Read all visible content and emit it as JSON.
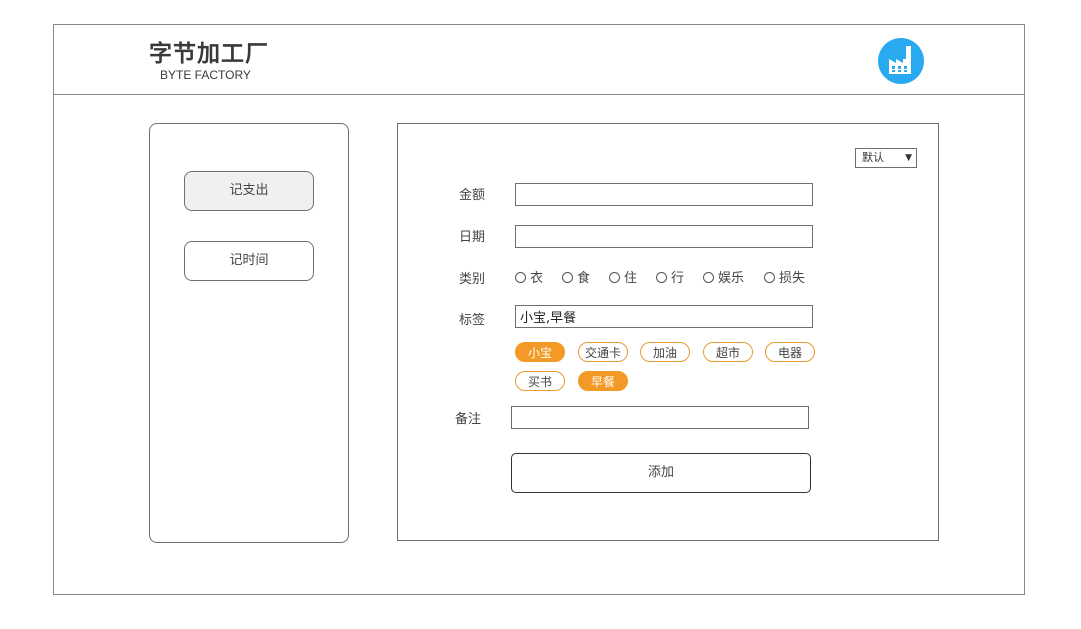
{
  "brand": {
    "title": "字节加工厂",
    "subtitle": "BYTE FACTORY",
    "logo_icon": "factory-icon",
    "logo_color": "#29aaf0"
  },
  "sidebar": {
    "items": [
      {
        "label": "记支出",
        "active": true
      },
      {
        "label": "记时间",
        "active": false
      }
    ]
  },
  "form": {
    "mode_select": {
      "value": "默认",
      "arrow": "▼"
    },
    "amount": {
      "label": "金额",
      "value": "",
      "placeholder": ""
    },
    "date": {
      "label": "日期",
      "value": "",
      "placeholder": ""
    },
    "category": {
      "label": "类别",
      "options": [
        "衣",
        "食",
        "住",
        "行",
        "娱乐",
        "损失"
      ]
    },
    "tags": {
      "label": "标签",
      "value": "小宝,早餐",
      "options": [
        {
          "label": "小宝",
          "selected": true
        },
        {
          "label": "交通卡",
          "selected": false
        },
        {
          "label": "加油",
          "selected": false
        },
        {
          "label": "超市",
          "selected": false
        },
        {
          "label": "电器",
          "selected": false
        },
        {
          "label": "买书",
          "selected": false
        },
        {
          "label": "早餐",
          "selected": true
        }
      ]
    },
    "note": {
      "label": "备注",
      "value": "",
      "placeholder": ""
    },
    "submit_label": "添加"
  },
  "colors": {
    "accent": "#f39a26",
    "border": "#6f6f6f"
  }
}
